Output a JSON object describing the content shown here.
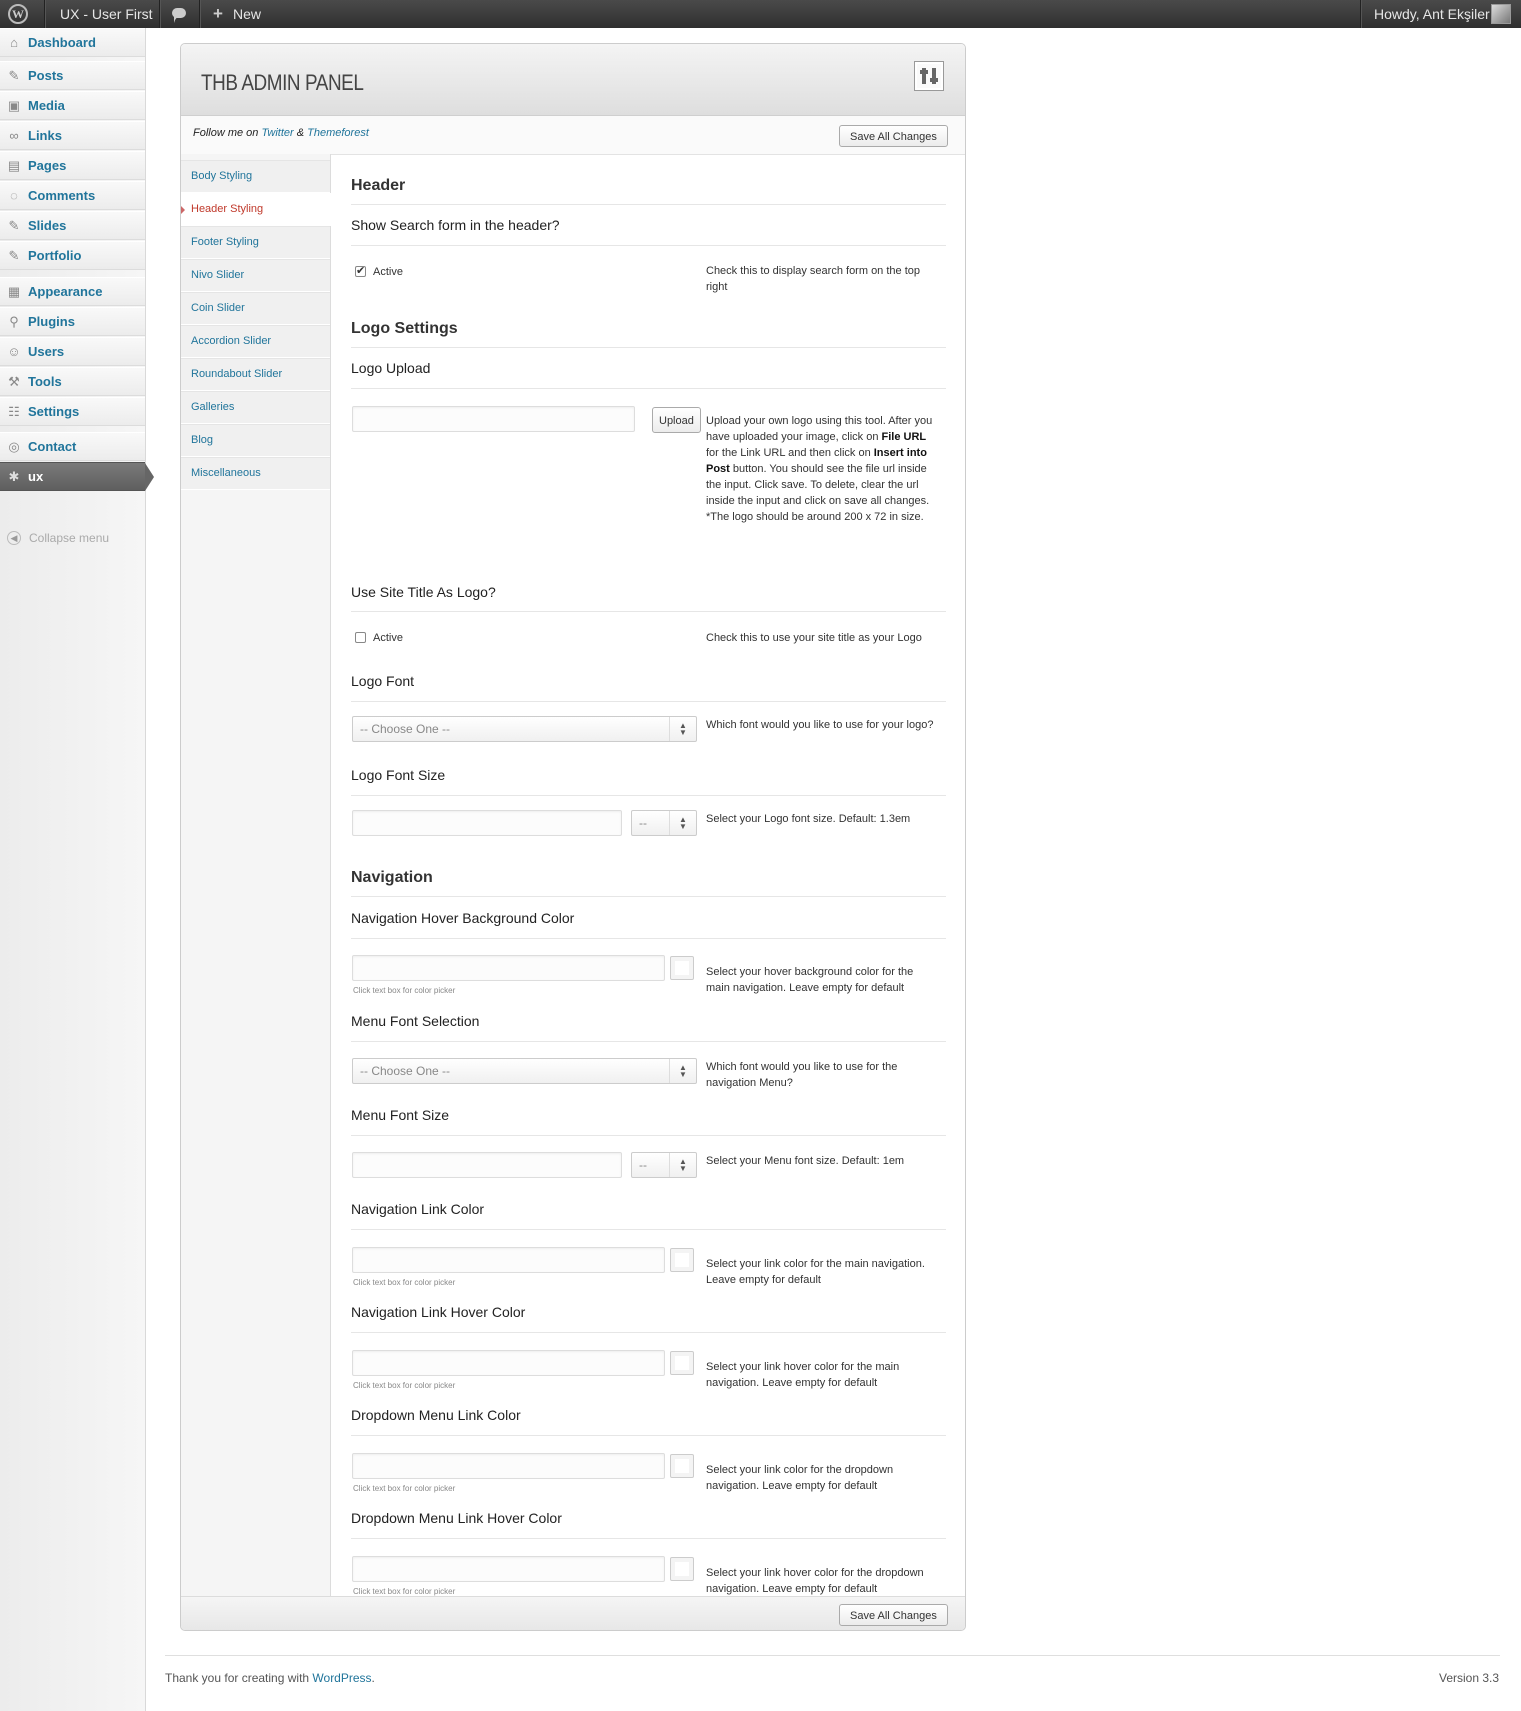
{
  "admin_bar": {
    "site_name": "UX - User First",
    "new_label": "New",
    "howdy": "Howdy, Ant Ekşiler"
  },
  "sidebar": {
    "items": [
      {
        "label": "Dashboard",
        "icon": "dashboard-icon"
      },
      {
        "label": "Posts",
        "icon": "pin-icon"
      },
      {
        "label": "Media",
        "icon": "media-icon"
      },
      {
        "label": "Links",
        "icon": "link-icon"
      },
      {
        "label": "Pages",
        "icon": "pages-icon"
      },
      {
        "label": "Comments",
        "icon": "comments-icon"
      },
      {
        "label": "Slides",
        "icon": "pin-icon"
      },
      {
        "label": "Portfolio",
        "icon": "pin-icon"
      },
      {
        "label": "Appearance",
        "icon": "appearance-icon"
      },
      {
        "label": "Plugins",
        "icon": "plugins-icon"
      },
      {
        "label": "Users",
        "icon": "users-icon"
      },
      {
        "label": "Tools",
        "icon": "tools-icon"
      },
      {
        "label": "Settings",
        "icon": "settings-icon"
      },
      {
        "label": "Contact",
        "icon": "contact-icon"
      },
      {
        "label": "ux",
        "icon": "star-icon"
      }
    ],
    "collapse_label": "Collapse menu"
  },
  "panel": {
    "title": "THB ADMIN PANEL",
    "follow_prefix": "Follow me on ",
    "twitter": "Twitter",
    "amp": " & ",
    "themeforest": "Themeforest",
    "save_label": "Save All Changes",
    "tabs": [
      "Body Styling",
      "Header Styling",
      "Footer Styling",
      "Nivo Slider",
      "Coin Slider",
      "Accordion Slider",
      "Roundabout Slider",
      "Galleries",
      "Blog",
      "Miscellaneous"
    ],
    "active_tab": "Header Styling"
  },
  "content": {
    "header_section": "Header",
    "search_title": "Show Search form in the header?",
    "search_active": "Active",
    "search_checked": true,
    "search_desc": "Check this to display search form on the top right",
    "logo_section": "Logo Settings",
    "logo_upload_title": "Logo Upload",
    "upload_button": "Upload",
    "logo_upload_desc": {
      "t1": "Upload your own logo using this tool. After you have uploaded your image, click on ",
      "b1": "File URL",
      "t2": " for the Link URL and then click on ",
      "b2": "Insert into Post",
      "t3": " button. You should see the file url inside the input. Click save. To delete, clear the url inside the input and click on save all changes. *The logo should be around 200 x 72 in size."
    },
    "site_title_title": "Use Site Title As Logo?",
    "site_title_active": "Active",
    "site_title_checked": false,
    "site_title_desc": "Check this to use your site title as your Logo",
    "logo_font_title": "Logo Font",
    "choose_one": "-- Choose One --",
    "logo_font_desc": "Which font would you like to use for your logo?",
    "logo_font_size_title": "Logo Font Size",
    "unit_placeholder": "--",
    "logo_font_size_desc": "Select your Logo font size. Default: 1.3em",
    "nav_section": "Navigation",
    "nav_hover_bg_title": "Navigation Hover Background Color",
    "color_hint": "Click text box for color picker",
    "nav_hover_bg_desc": "Select your hover background color for the main navigation. Leave empty for default",
    "menu_font_title": "Menu Font Selection",
    "menu_font_desc": "Which font would you like to use for the navigation Menu?",
    "menu_font_size_title": "Menu Font Size",
    "menu_font_size_desc": "Select your Menu font size. Default: 1em",
    "nav_link_title": "Navigation Link Color",
    "nav_link_desc": "Select your link color for the main navigation. Leave empty for default",
    "nav_link_hover_title": "Navigation Link Hover Color",
    "nav_link_hover_desc": "Select your link hover color for the main navigation. Leave empty for default",
    "dd_link_title": "Dropdown Menu Link Color",
    "dd_link_desc": "Select your link color for the dropdown navigation. Leave empty for default",
    "dd_link_hover_title": "Dropdown Menu Link Hover Color",
    "dd_link_hover_desc": "Select your link hover color for the dropdown navigation. Leave empty for default"
  },
  "footer": {
    "thanks_prefix": "Thank you for creating with ",
    "wordpress": "WordPress",
    "thanks_suffix": ".",
    "version": "Version 3.3"
  },
  "colors": {
    "link": "#21759b",
    "active_tab": "#c0392b",
    "admin_bar": "#3a3a3a"
  }
}
